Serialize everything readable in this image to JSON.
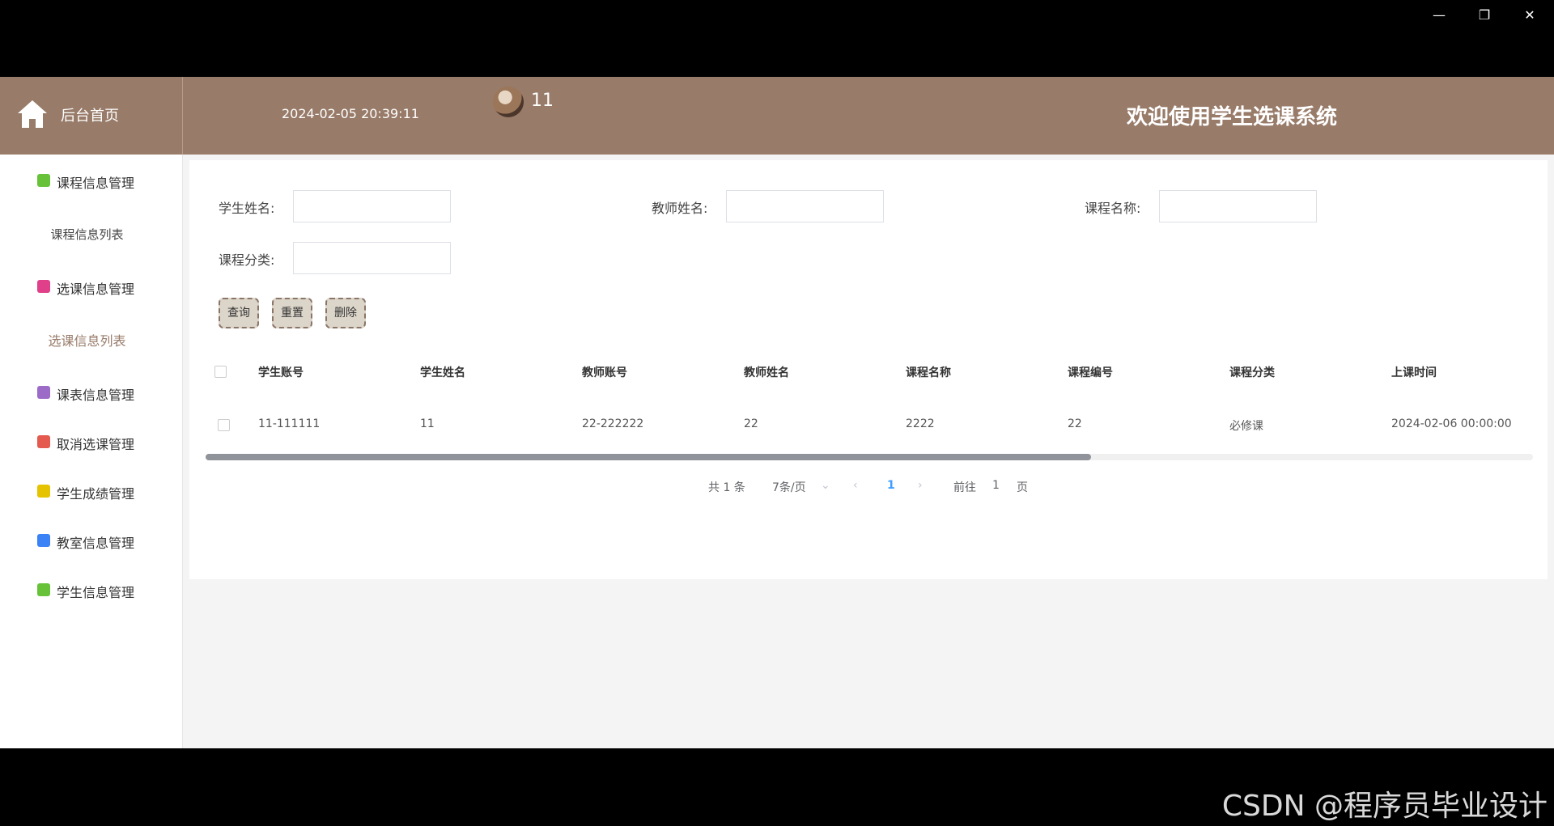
{
  "window": {
    "minimize": "—",
    "restore": "❐",
    "close": "✕"
  },
  "header": {
    "home_label": "后台首页",
    "datetime": "2024-02-05 20:39:11",
    "username": "11",
    "welcome": "欢迎使用学生选课系统",
    "bg_color": "#987b69"
  },
  "sidebar": {
    "items": [
      {
        "label": "课程信息管理",
        "icon": "chat-icon",
        "color": "#67c23a"
      },
      {
        "sub": "课程信息列表"
      },
      {
        "label": "选课信息管理",
        "icon": "bag-icon",
        "color": "#e0408a"
      },
      {
        "sub": "选课信息列表"
      },
      {
        "label": "课表信息管理",
        "icon": "archive-icon",
        "color": "#9b6bc7"
      },
      {
        "label": "取消选课管理",
        "icon": "grid-icon",
        "color": "#e45a4f"
      },
      {
        "label": "学生成绩管理",
        "icon": "cube-icon",
        "color": "#e6c300"
      },
      {
        "label": "教室信息管理",
        "icon": "star-icon",
        "color": "#3b82f6"
      },
      {
        "label": "学生信息管理",
        "icon": "chat-icon",
        "color": "#67c23a"
      }
    ]
  },
  "search": {
    "student_name_label": "学生姓名:",
    "teacher_name_label": "教师姓名:",
    "course_name_label": "课程名称:",
    "course_category_label": "课程分类:",
    "student_name_value": "",
    "teacher_name_value": "",
    "course_name_value": "",
    "course_category_value": ""
  },
  "buttons": {
    "query": "查询",
    "reset": "重置",
    "delete": "删除"
  },
  "table": {
    "headers": [
      "学生账号",
      "学生姓名",
      "教师账号",
      "教师姓名",
      "课程名称",
      "课程编号",
      "课程分类",
      "上课时间"
    ],
    "rows": [
      [
        "11-111111",
        "11",
        "22-222222",
        "22",
        "2222",
        "22",
        "必修课",
        "2024-02-06 00:00:00"
      ]
    ]
  },
  "pagination": {
    "total": "共 1 条",
    "page_size": "7条/页",
    "current": "1",
    "goto_label": "前往",
    "goto_value": "1",
    "page_suffix": "页"
  },
  "watermark": "CSDN @程序员毕业设计"
}
